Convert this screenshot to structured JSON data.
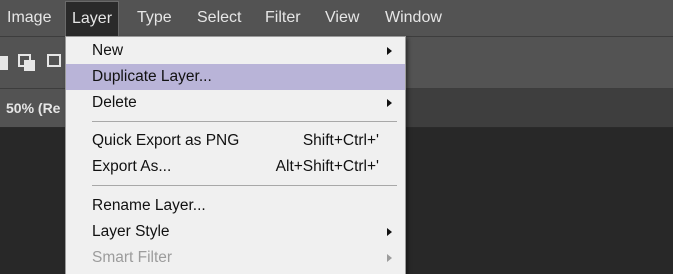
{
  "menubar": {
    "items": [
      {
        "label": "Image"
      },
      {
        "label": "Layer"
      },
      {
        "label": "Type"
      },
      {
        "label": "Select"
      },
      {
        "label": "Filter"
      },
      {
        "label": "View"
      },
      {
        "label": "Window"
      }
    ],
    "active": "Layer"
  },
  "document": {
    "tab_label": "50% (Re"
  },
  "layer_menu": {
    "items": [
      {
        "label": "New",
        "shortcut": "",
        "submenu": true,
        "state": "enabled"
      },
      {
        "label": "Duplicate Layer...",
        "shortcut": "",
        "submenu": false,
        "state": "highlighted"
      },
      {
        "label": "Delete",
        "shortcut": "",
        "submenu": true,
        "state": "enabled"
      },
      {
        "label": "Quick Export as PNG",
        "shortcut": "Shift+Ctrl+'",
        "submenu": false,
        "state": "enabled"
      },
      {
        "label": "Export As...",
        "shortcut": "Alt+Shift+Ctrl+'",
        "submenu": false,
        "state": "enabled"
      },
      {
        "label": "Rename Layer...",
        "shortcut": "",
        "submenu": false,
        "state": "enabled"
      },
      {
        "label": "Layer Style",
        "shortcut": "",
        "submenu": true,
        "state": "enabled"
      },
      {
        "label": "Smart Filter",
        "shortcut": "",
        "submenu": true,
        "state": "disabled"
      }
    ]
  },
  "colors": {
    "menubar_bg": "#535353",
    "menu_bg": "#f0f0f0",
    "highlight": "#b9b4d8",
    "canvas_bg": "#282828",
    "disabled_text": "#9c9c9c"
  }
}
